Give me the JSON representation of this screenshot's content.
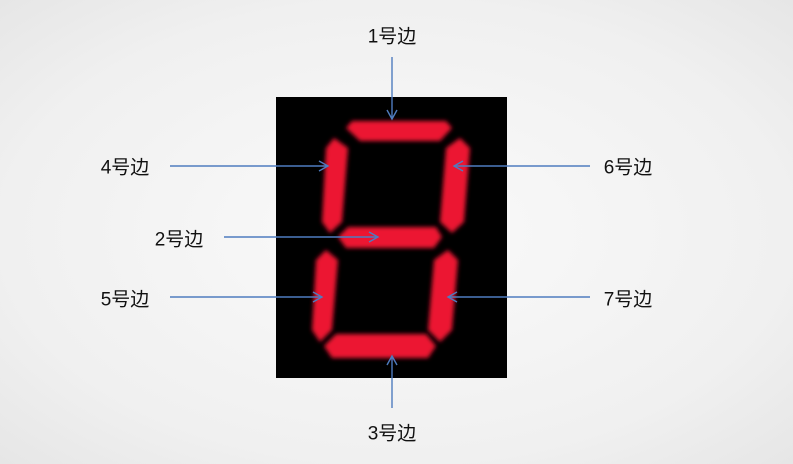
{
  "labels": {
    "seg1": "1号边",
    "seg2": "2号边",
    "seg3": "3号边",
    "seg4": "4号边",
    "seg5": "5号边",
    "seg6": "6号边",
    "seg7": "7号边"
  },
  "colors": {
    "segment": "#ec1530",
    "arrow": "#4f7cbf",
    "display": "#000000"
  }
}
